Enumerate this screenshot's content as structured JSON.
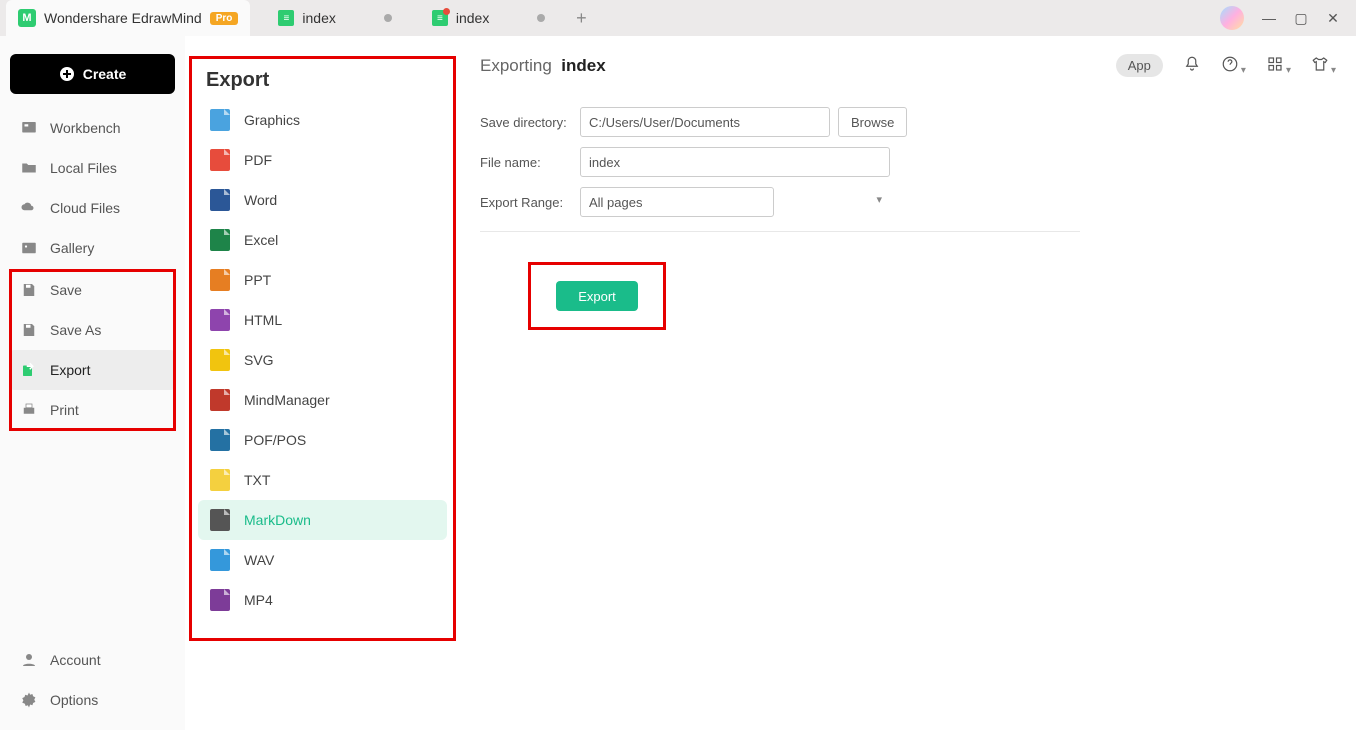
{
  "titlebar": {
    "app_name": "Wondershare EdrawMind",
    "pro_badge": "Pro",
    "tabs": [
      {
        "label": "index",
        "modified": false
      },
      {
        "label": "index",
        "modified": true
      }
    ]
  },
  "leftnav": {
    "create_label": "Create",
    "items": [
      {
        "id": "workbench",
        "label": "Workbench"
      },
      {
        "id": "localfiles",
        "label": "Local Files"
      },
      {
        "id": "cloudfiles",
        "label": "Cloud Files"
      },
      {
        "id": "gallery",
        "label": "Gallery"
      }
    ],
    "file_items": [
      {
        "id": "save",
        "label": "Save"
      },
      {
        "id": "saveas",
        "label": "Save As"
      },
      {
        "id": "export",
        "label": "Export",
        "active": true
      },
      {
        "id": "print",
        "label": "Print"
      }
    ],
    "bottom": [
      {
        "id": "account",
        "label": "Account"
      },
      {
        "id": "options",
        "label": "Options"
      }
    ]
  },
  "export_panel": {
    "title": "Export",
    "formats": [
      {
        "label": "Graphics",
        "color": "#4aa3df"
      },
      {
        "label": "PDF",
        "color": "#e74c3c"
      },
      {
        "label": "Word",
        "color": "#2b5797"
      },
      {
        "label": "Excel",
        "color": "#1e8449"
      },
      {
        "label": "PPT",
        "color": "#e67e22"
      },
      {
        "label": "HTML",
        "color": "#8e44ad"
      },
      {
        "label": "SVG",
        "color": "#f1c40f"
      },
      {
        "label": "MindManager",
        "color": "#c0392b"
      },
      {
        "label": "POF/POS",
        "color": "#2471a3"
      },
      {
        "label": "TXT",
        "color": "#f4d03f"
      },
      {
        "label": "MarkDown",
        "color": "#555555",
        "selected": true
      },
      {
        "label": "WAV",
        "color": "#3498db"
      },
      {
        "label": "MP4",
        "color": "#7d3c98"
      }
    ]
  },
  "page": {
    "header_prefix": "Exporting",
    "header_file": "index",
    "toolbar": {
      "app_label": "App"
    },
    "form": {
      "save_dir_label": "Save directory:",
      "save_dir_value": "C:/Users/User/Documents",
      "browse_label": "Browse",
      "filename_label": "File name:",
      "filename_value": "index",
      "range_label": "Export Range:",
      "range_value": "All pages"
    },
    "export_button": "Export"
  }
}
